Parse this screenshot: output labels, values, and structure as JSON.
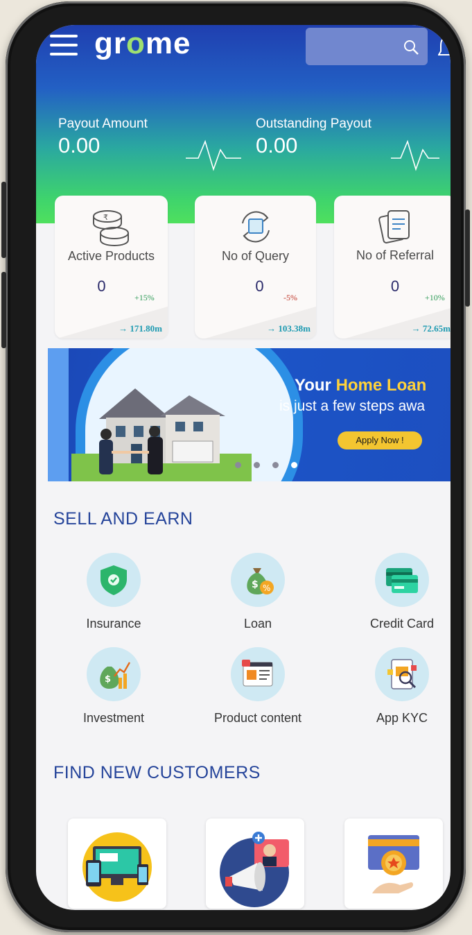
{
  "app": {
    "logo_pre": "gr",
    "logo_o": "o",
    "logo_post": "me"
  },
  "header": {
    "payout_label": "Payout Amount",
    "payout_value": "0.00",
    "outstanding_label": "Outstanding Payout",
    "outstanding_value": "0.00"
  },
  "stats": [
    {
      "title": "Active Products",
      "value": "0",
      "change": "+15%",
      "change_color": "#2e9b57",
      "amount": "→ 171.80m"
    },
    {
      "title": "No of Query",
      "value": "0",
      "change": "-5%",
      "change_color": "#c0392b",
      "amount": "→ 103.38m"
    },
    {
      "title": "No of Referral",
      "value": "0",
      "change": "+10%",
      "change_color": "#2e9b57",
      "amount": "→ 72.65m"
    }
  ],
  "banner": {
    "line1_pre": "Your ",
    "line1_highlight": "Home Loan",
    "line2": "is just a few steps awa",
    "cta": "Apply Now !",
    "slides": 4,
    "active_slide": 4
  },
  "sell_and_earn": {
    "title": "SELL AND EARN",
    "items": [
      {
        "label": "Insurance",
        "icon": "shield-icon"
      },
      {
        "label": "Loan",
        "icon": "money-bag-icon"
      },
      {
        "label": "Credit Card",
        "icon": "credit-card-icon"
      },
      {
        "label": "Investment",
        "icon": "investment-growth-icon"
      },
      {
        "label": "Product content",
        "icon": "web-content-icon"
      },
      {
        "label": "App KYC",
        "icon": "kyc-document-icon"
      }
    ]
  },
  "find_new_customers": {
    "title": "FIND NEW CUSTOMERS",
    "items": [
      {
        "icon": "devices-icon"
      },
      {
        "icon": "megaphone-icon"
      },
      {
        "icon": "reward-badge-icon"
      }
    ]
  },
  "colors": {
    "brand_blue": "#1f3fb0",
    "brand_green": "#4fe05e",
    "section_title": "#25449a",
    "accent_yellow": "#f3c530"
  }
}
